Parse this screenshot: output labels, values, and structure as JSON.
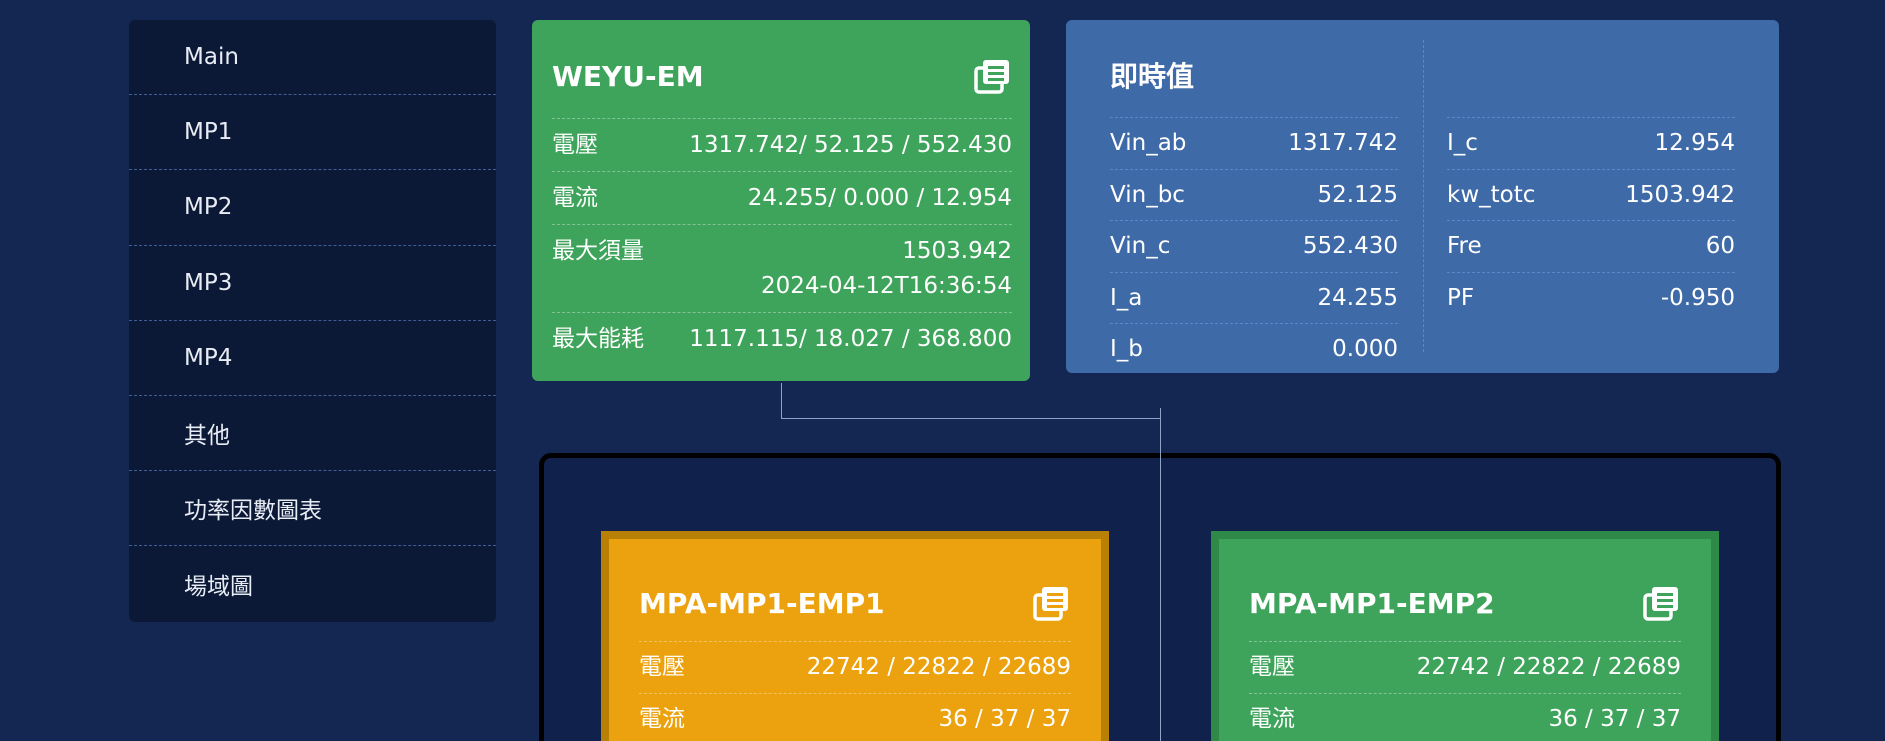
{
  "sidebar": {
    "items": [
      {
        "label": "Main"
      },
      {
        "label": "MP1"
      },
      {
        "label": "MP2"
      },
      {
        "label": "MP3"
      },
      {
        "label": "MP4"
      },
      {
        "label": "其他"
      },
      {
        "label": "功率因數圖表"
      },
      {
        "label": "場域圖"
      }
    ]
  },
  "main_card": {
    "title": "WEYU-EM",
    "icon": "copy-icon",
    "color": "#3fa45b",
    "rows": {
      "voltage": {
        "label": "電壓",
        "value": "1317.742/ 52.125 / 552.430"
      },
      "current": {
        "label": "電流",
        "value": "24.255/ 0.000 / 12.954"
      },
      "max_demand": {
        "label": "最大須量",
        "value": "1503.942",
        "time": "2024-04-12T16:36:54"
      },
      "max_energy": {
        "label": "最大能耗",
        "value": "1117.115/ 18.027 / 368.800"
      }
    }
  },
  "realtime": {
    "title": "即時值",
    "color": "#3f6aa8",
    "left": [
      {
        "label": "Vin_ab",
        "value": "1317.742"
      },
      {
        "label": "Vin_bc",
        "value": "52.125"
      },
      {
        "label": "Vin_c",
        "value": "552.430"
      },
      {
        "label": "I_a",
        "value": "24.255"
      },
      {
        "label": "I_b",
        "value": "0.000"
      }
    ],
    "right": [
      {
        "label": "I_c",
        "value": "12.954"
      },
      {
        "label": "kw_totc",
        "value": "1503.942"
      },
      {
        "label": "Fre",
        "value": "60"
      },
      {
        "label": "PF",
        "value": "-0.950"
      }
    ]
  },
  "sub_cards": [
    {
      "title": "MPA-MP1-EMP1",
      "icon": "copy-icon",
      "color": "#eba20e",
      "voltage": {
        "label": "電壓",
        "value": "22742 / 22822 / 22689"
      },
      "current": {
        "label": "電流",
        "value": "36 / 37 / 37"
      }
    },
    {
      "title": "MPA-MP1-EMP2",
      "icon": "copy-icon",
      "color": "#3fa45b",
      "voltage": {
        "label": "電壓",
        "value": "22742 / 22822 / 22689"
      },
      "current": {
        "label": "電流",
        "value": "36 / 37 / 37"
      }
    }
  ]
}
